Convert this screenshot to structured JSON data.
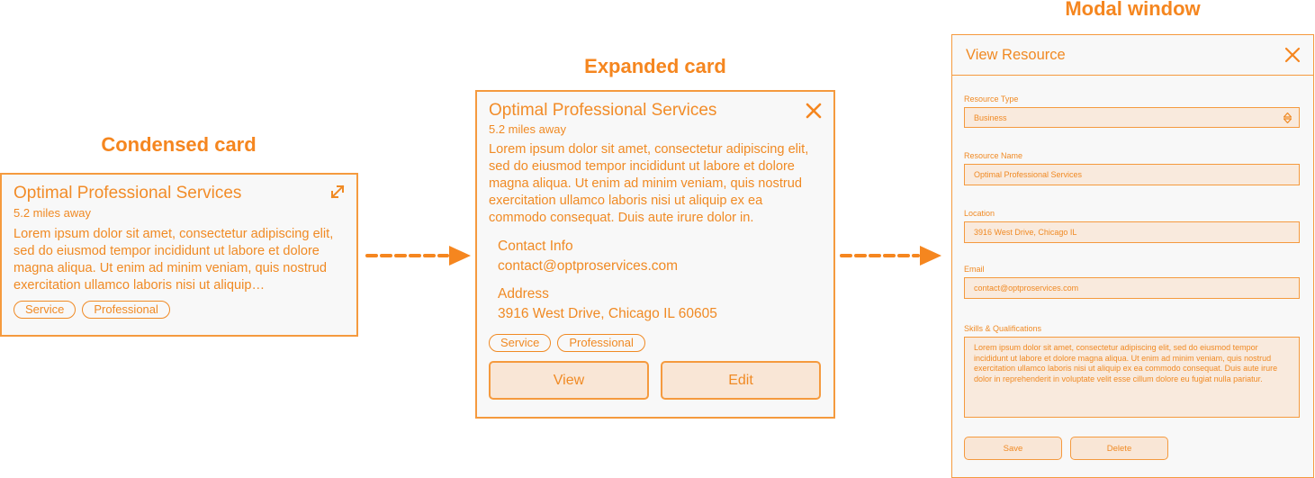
{
  "sections": {
    "condensed_title": "Condensed card",
    "expanded_title": "Expanded card",
    "modal_title": "Modal window"
  },
  "condensed_card": {
    "title": "Optimal Professional Services",
    "distance": "5.2 miles away",
    "description": "Lorem ipsum dolor sit amet, consectetur adipiscing elit, sed do eiusmod tempor incididunt ut labore et dolore magna aliqua. Ut enim ad minim veniam, quis nostrud exercitation ullamco laboris nisi ut aliquip…",
    "tags": [
      "Service",
      "Professional"
    ],
    "expand_icon": "expand-diagonal-arrows-icon"
  },
  "expanded_card": {
    "title": "Optimal Professional Services",
    "distance": "5.2 miles away",
    "description": "Lorem ipsum dolor sit amet, consectetur adipiscing elit, sed do eiusmod tempor incididunt ut labore et dolore magna aliqua. Ut enim ad minim veniam, quis nostrud exercitation ullamco laboris nisi ut aliquip ex ea commodo consequat. Duis aute irure dolor in.",
    "contact_label": "Contact Info",
    "contact_value": "contact@optproservices.com",
    "address_label": "Address",
    "address_value": "3916 West Drive, Chicago IL 60605",
    "tags": [
      "Service",
      "Professional"
    ],
    "view_label": "View",
    "edit_label": "Edit",
    "close_icon": "close-x-icon"
  },
  "modal": {
    "header": "View Resource",
    "close_icon": "close-x-icon",
    "resource_type_label": "Resource Type",
    "resource_type_value": "Business",
    "resource_name_label": "Resource Name",
    "resource_name_value": "Optimal Professional Services",
    "location_label": "Location",
    "location_value": "3916 West Drive, Chicago IL",
    "email_label": "Email",
    "email_value": "contact@optproservices.com",
    "skills_label": "Skills & Qualifications",
    "skills_value": "Lorem ipsum dolor sit amet, consectetur adipiscing elit, sed do eiusmod tempor incididunt ut labore et dolore magna aliqua. Ut enim ad minim veniam, quis nostrud exercitation ullamco laboris nisi ut aliquip ex ea commodo consequat. Duis aute irure dolor in reprehenderit in voluptate velit esse cillum dolore eu fugiat nulla pariatur.",
    "save_label": "Save",
    "delete_label": "Delete"
  },
  "colors": {
    "accent": "#f5861f",
    "border": "#f59a3e",
    "field_fill": "#f9eadd",
    "card_bg": "#f8f8f8"
  }
}
